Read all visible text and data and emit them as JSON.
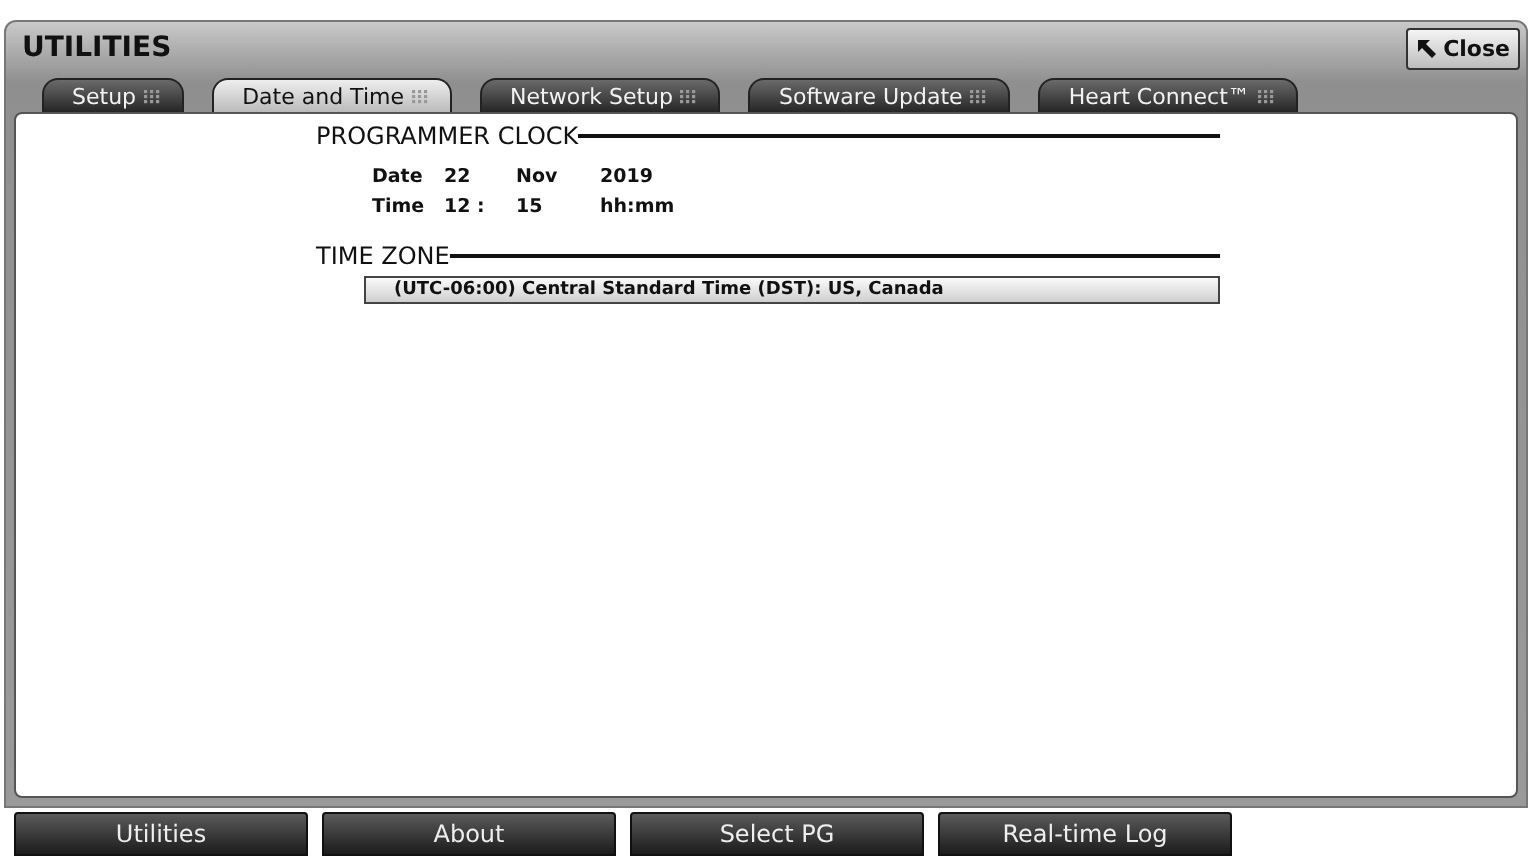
{
  "window": {
    "title": "UTILITIES",
    "close_button": "Close"
  },
  "tabs": [
    {
      "label": "Setup",
      "selected": false
    },
    {
      "label": "Date and Time",
      "selected": true
    },
    {
      "label": "Network Setup",
      "selected": false
    },
    {
      "label": "Software Update",
      "selected": false
    },
    {
      "label": "Heart Connect™",
      "selected": false
    }
  ],
  "programmer_clock": {
    "heading": "PROGRAMMER CLOCK",
    "rows": [
      {
        "label": "Date",
        "values": [
          "22",
          "Nov",
          "2019"
        ]
      },
      {
        "label": "Time",
        "values": [
          "12 :",
          "15",
          "hh:mm"
        ]
      }
    ]
  },
  "time_zone": {
    "heading": "TIME ZONE",
    "value": "(UTC-06:00) Central Standard Time (DST): US, Canada"
  },
  "bottom_buttons": [
    "Utilities",
    "About",
    "Select PG",
    "Real-time Log"
  ]
}
